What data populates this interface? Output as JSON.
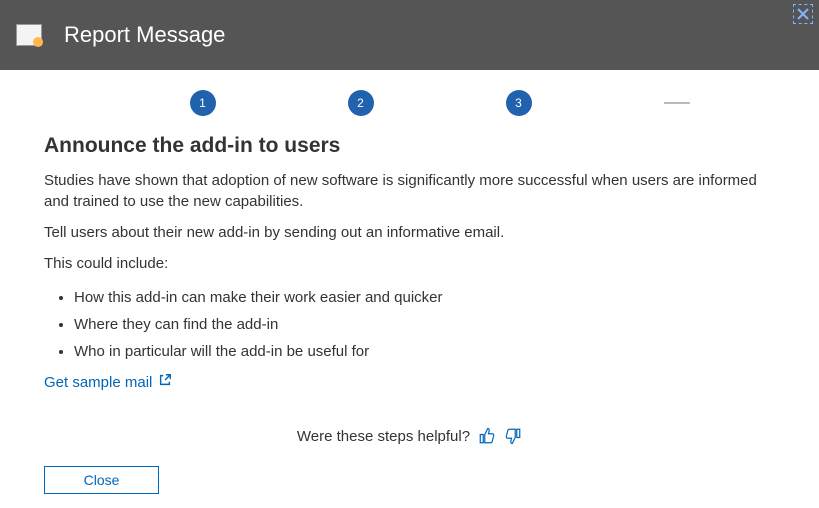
{
  "header": {
    "title": "Report Message"
  },
  "steps": {
    "items": [
      "1",
      "2",
      "3"
    ]
  },
  "section": {
    "title": "Announce the add-in to users",
    "p1": "Studies have shown that adoption of new software is significantly more successful when users are informed and trained to use the new capabilities.",
    "p2": "Tell users about their new add-in by sending out an informative email.",
    "p3": "This could include:",
    "bullets": [
      "How this add-in can make their work easier and quicker",
      "Where they can find the add-in",
      "Who in particular will the add-in be useful for"
    ],
    "link": "Get sample mail"
  },
  "feedback": {
    "prompt": "Were these steps helpful?"
  },
  "footer": {
    "close": "Close"
  }
}
